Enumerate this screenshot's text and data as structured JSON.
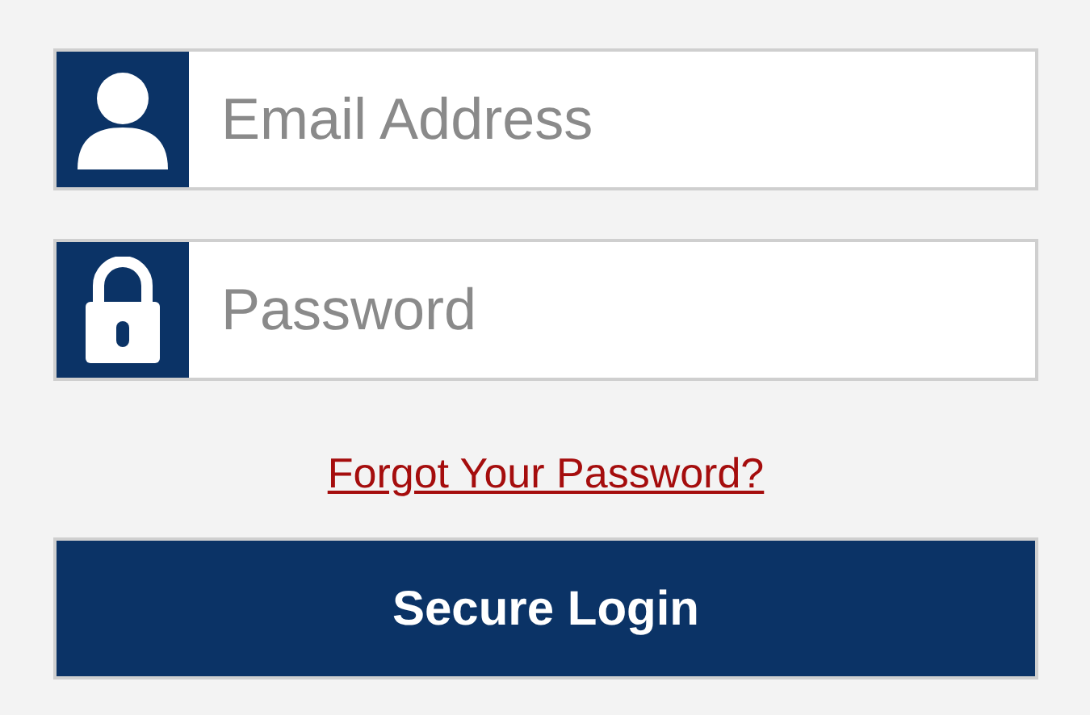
{
  "fields": [
    {
      "kind": "email",
      "placeholder": "Email Address"
    },
    {
      "kind": "password",
      "placeholder": "Password"
    }
  ],
  "forgot_link": "Forgot Your Password?",
  "login_button": "Secure Login"
}
